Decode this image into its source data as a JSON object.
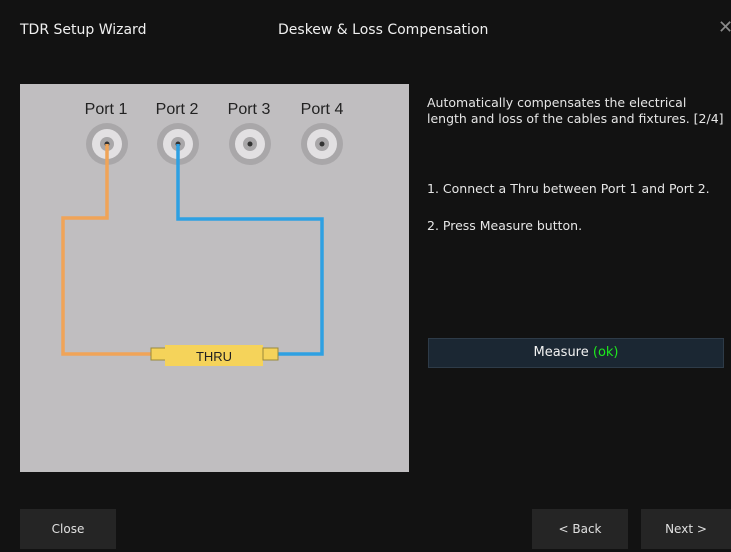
{
  "window": {
    "title": "TDR Setup Wizard",
    "step_title": "Deskew & Loss Compensation",
    "close_glyph": "✕"
  },
  "diagram": {
    "ports": [
      "Port 1",
      "Port 2",
      "Port 3",
      "Port 4"
    ],
    "thru_label": "THRU",
    "colors": {
      "background": "#c0bec0",
      "cable_port1": "#f0a458",
      "cable_port2": "#2ea0e2",
      "thru_body": "#f5d35a",
      "connector": "#f5d35a"
    }
  },
  "instructions": {
    "description": "Automatically compensates the electrical length and loss of the cables and fixtures. [2/4]",
    "step1": "1. Connect a Thru between Port 1 and Port 2.",
    "step2": "2. Press Measure button."
  },
  "measure_button": {
    "label": "Measure",
    "status": "(ok)",
    "status_color": "#1ee81e"
  },
  "footer": {
    "close_label": "Close",
    "back_label": "< Back",
    "next_label": "Next >"
  }
}
